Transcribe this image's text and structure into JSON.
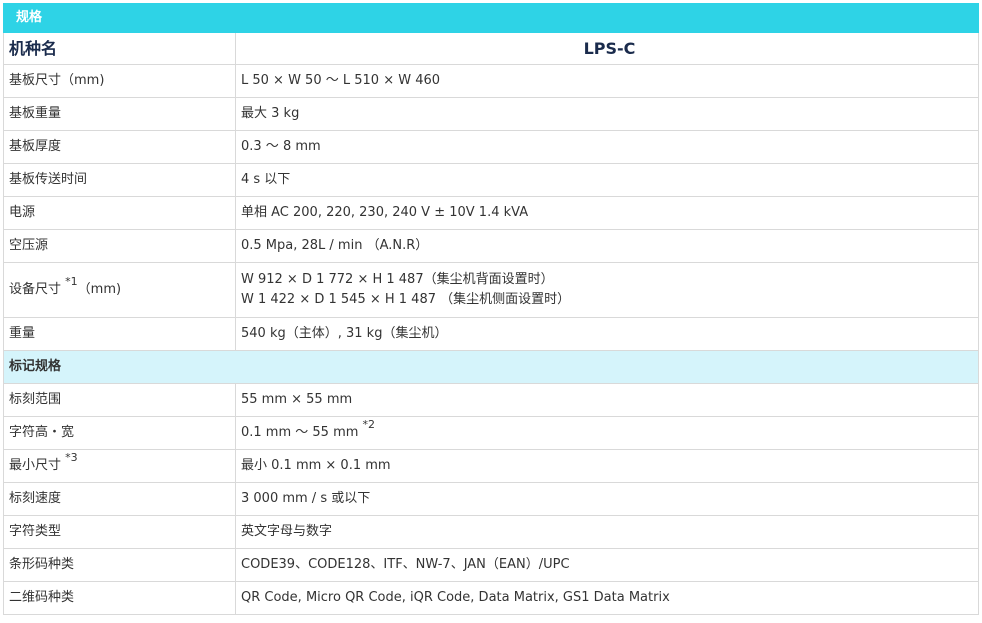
{
  "spec_header": "规格",
  "model": {
    "label": "机种名",
    "value": "LPS-C"
  },
  "spec_rows": [
    {
      "label": "基板尺寸（mm)",
      "value": "L 50 × W 50 ～ L 510 × W 460"
    },
    {
      "label": "基板重量",
      "value": "最大 3 kg"
    },
    {
      "label": "基板厚度",
      "value": "0.3 ～ 8 mm"
    },
    {
      "label": "基板传送时间",
      "value": "4 s 以下"
    },
    {
      "label": "电源",
      "value": "单相 AC 200, 220, 230, 240 V ± 10V 1.4 kVA"
    },
    {
      "label": "空压源",
      "value": "0.5 Mpa, 28L / min （A.N.R）"
    }
  ],
  "equipment_size": {
    "label": "设备尺寸",
    "note": "*1",
    "unit": "（mm)",
    "line1": "W 912 × D 1 772 × H 1 487（集尘机背面设置时）",
    "line2": "W 1 422 × D 1 545 × H 1 487 （集尘机侧面设置时）"
  },
  "weight": {
    "label": "重量",
    "value": "540 kg（主体）, 31 kg（集尘机）"
  },
  "marking_header": "标记规格",
  "marking_rows_a": [
    {
      "label": "标刻范围",
      "value": "55 mm × 55 mm"
    }
  ],
  "char_size": {
    "label": "字符高・宽",
    "value": "0.1 mm ～ 55 mm",
    "note": "*2"
  },
  "min_size": {
    "label": "最小尺寸",
    "note": "*3",
    "value": "最小 0.1 mm × 0.1 mm"
  },
  "marking_rows_b": [
    {
      "label": "标刻速度",
      "value": "3 000 mm / s 或以下"
    },
    {
      "label": "字符类型",
      "value": "英文字母与数字"
    },
    {
      "label": "条形码种类",
      "value": "CODE39、CODE128、ITF、NW-7、JAN（EAN）/UPC"
    },
    {
      "label": "二维码种类",
      "value": "QR Code, Micro QR Code, iQR Code, Data Matrix, GS1 Data Matrix"
    }
  ]
}
